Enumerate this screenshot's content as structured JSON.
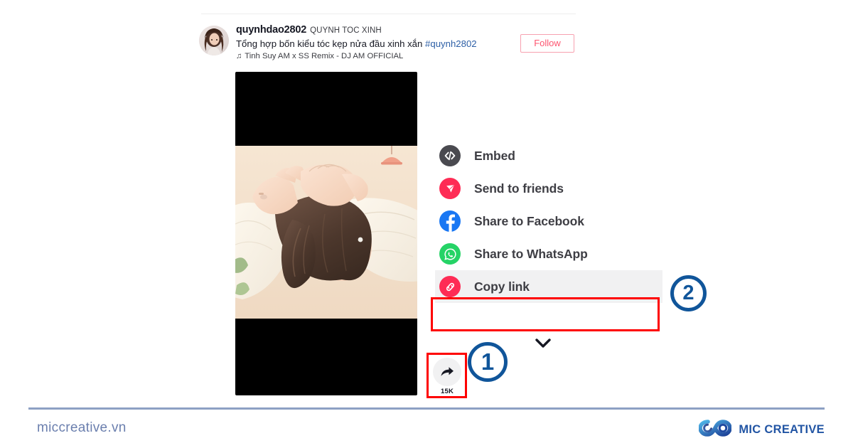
{
  "post": {
    "username": "quynhdao2802",
    "nickname": "QUYNH TOC XINH",
    "caption_text": "Tổng hợp bốn kiểu tóc kẹp nửa đầu xinh xắn ",
    "caption_hashtag": "#quynh2802",
    "music_note": "♫",
    "music_text": "Tinh Suy AM x SS Remix - DJ AM OFFICIAL",
    "follow_label": "Follow",
    "avatar_icon": "user-avatar-photo"
  },
  "share_menu": {
    "items": [
      {
        "label": "Embed",
        "icon": "embed-code-icon",
        "color": "#4a4a50",
        "active": false
      },
      {
        "label": "Send to friends",
        "icon": "send-paperplane-icon",
        "color": "#fe2c55",
        "active": false
      },
      {
        "label": "Share to Facebook",
        "icon": "facebook-icon",
        "color": "#1977f3",
        "active": false
      },
      {
        "label": "Share to WhatsApp",
        "icon": "whatsapp-icon",
        "color": "#25d366",
        "active": false
      },
      {
        "label": "Copy link",
        "icon": "link-chain-icon",
        "color": "#fe2c55",
        "active": true
      }
    ],
    "expand_icon": "chevron-down-icon"
  },
  "share_button": {
    "icon": "share-arrow-icon",
    "count": "15K"
  },
  "annotations": {
    "step_one": "1",
    "step_two": "2",
    "highlight_color": "#fe0000",
    "marker_color": "#10559a"
  },
  "footer": {
    "url": "miccreative.vn",
    "brand": "MIC CREATIVE",
    "logo_icon": "mic-creative-infinity-logo",
    "divider_color": "#8da0c4"
  }
}
